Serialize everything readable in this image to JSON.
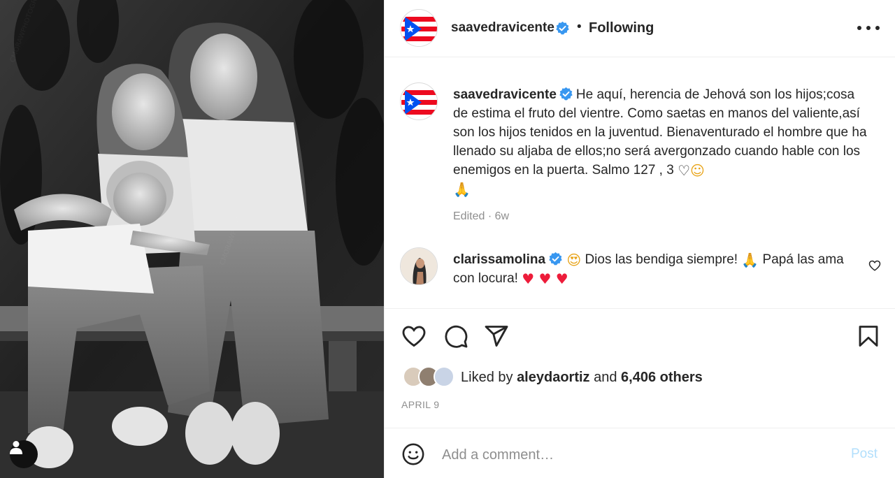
{
  "post": {
    "author": "saavedravicente",
    "follow_state": "Following",
    "separator": "•",
    "caption": "He aquí, herencia de Jehová son los hijos;cosa de estima el fruto del vientre. Como saetas en manos del valiente,así son los hijos tenidos en la juventud. Bienaventurado el hombre que ha llenado su aljaba de ellos;no será avergonzado cuando hable con los enemigos en la puerta. Salmo 127 , 3",
    "caption_emojis": [
      "♡",
      "☺",
      "🙏"
    ],
    "caption_meta": "Edited · 6w",
    "likes_prefix": "Liked by",
    "liked_by_user": "aleydaortiz",
    "likes_joiner": "and",
    "likes_others": "6,406 others",
    "date": "APRIL 9"
  },
  "comment": {
    "author": "clarissamolina",
    "lead_emoji": "😍",
    "text_part1": "Dios las bendiga siempre!",
    "pray_emoji": "🙏",
    "text_part2": "Papá las ama con locura!",
    "hearts": "♥ ♥ ♥"
  },
  "composer": {
    "placeholder": "Add a comment…",
    "post_label": "Post"
  },
  "colors": {
    "verified_blue": "#3897f0",
    "post_button_disabled": "#b2dffc",
    "secondary_text": "#8e8e8e"
  },
  "icons": [
    "verified-badge-icon",
    "more-options-icon",
    "heart-outline-icon",
    "comment-icon",
    "share-icon",
    "bookmark-icon",
    "emoji-icon",
    "user-tag-icon",
    "puerto-rico-flag-icon"
  ]
}
